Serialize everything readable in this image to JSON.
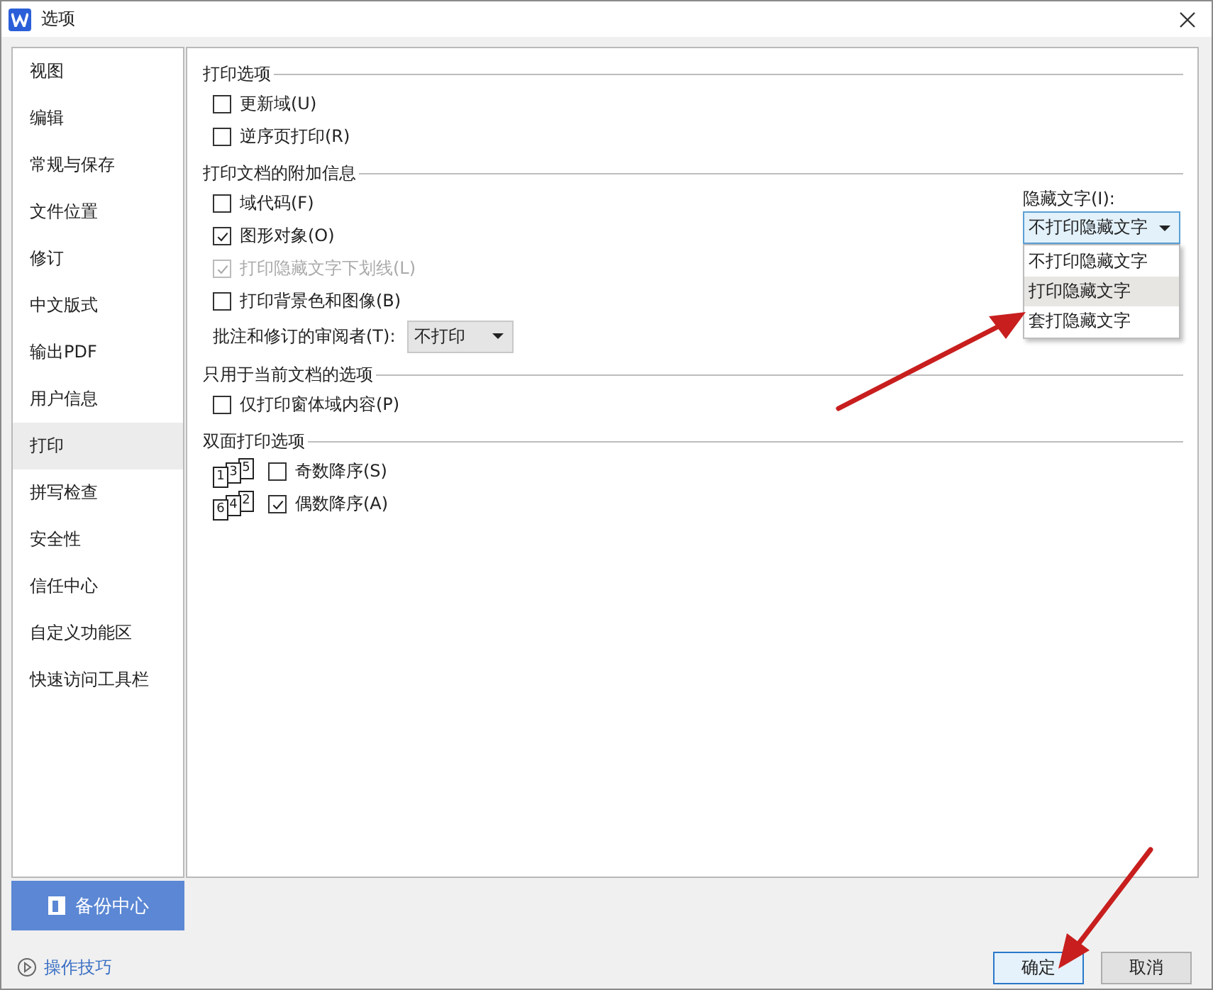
{
  "window": {
    "title": "选项"
  },
  "sidebar": {
    "items": [
      {
        "label": "视图",
        "selected": false
      },
      {
        "label": "编辑",
        "selected": false
      },
      {
        "label": "常规与保存",
        "selected": false
      },
      {
        "label": "文件位置",
        "selected": false
      },
      {
        "label": "修订",
        "selected": false
      },
      {
        "label": "中文版式",
        "selected": false
      },
      {
        "label": "输出PDF",
        "selected": false
      },
      {
        "label": "用户信息",
        "selected": false
      },
      {
        "label": "打印",
        "selected": true
      },
      {
        "label": "拼写检查",
        "selected": false
      },
      {
        "label": "安全性",
        "selected": false
      },
      {
        "label": "信任中心",
        "selected": false
      },
      {
        "label": "自定义功能区",
        "selected": false
      },
      {
        "label": "快速访问工具栏",
        "selected": false
      }
    ]
  },
  "backup_button": "备份中心",
  "tips_link": "操作技巧",
  "sections": [
    {
      "title": "打印选项",
      "items": [
        {
          "kind": "checkbox",
          "label": "更新域(U)",
          "checked": false,
          "disabled": false
        },
        {
          "kind": "checkbox",
          "label": "逆序页打印(R)",
          "checked": false,
          "disabled": false
        }
      ]
    },
    {
      "title": "打印文档的附加信息",
      "items": [
        {
          "kind": "checkbox",
          "label": "域代码(F)",
          "checked": false,
          "disabled": false
        },
        {
          "kind": "checkbox",
          "label": "图形对象(O)",
          "checked": true,
          "disabled": false
        },
        {
          "kind": "checkbox",
          "label": "打印隐藏文字下划线(L)",
          "checked": true,
          "disabled": true
        },
        {
          "kind": "checkbox",
          "label": "打印背景色和图像(B)",
          "checked": false,
          "disabled": false
        },
        {
          "kind": "select",
          "label": "批注和修订的审阅者(T):",
          "value": "不打印"
        }
      ],
      "hidden_text": {
        "label": "隐藏文字(I):",
        "value": "不打印隐藏文字",
        "expanded": true,
        "options": [
          {
            "label": "不打印隐藏文字",
            "highlighted": false
          },
          {
            "label": "打印隐藏文字",
            "highlighted": true
          },
          {
            "label": "套打隐藏文字",
            "highlighted": false
          }
        ]
      }
    },
    {
      "title": "只用于当前文档的选项",
      "items": [
        {
          "kind": "checkbox",
          "label": "仅打印窗体域内容(P)",
          "checked": false,
          "disabled": false
        }
      ]
    },
    {
      "title": "双面打印选项",
      "items": [
        {
          "kind": "duplex",
          "pages": [
            "1",
            "3",
            "5"
          ],
          "label": "奇数降序(S)",
          "checked": false,
          "disabled": false
        },
        {
          "kind": "duplex",
          "pages": [
            "6",
            "4",
            "2"
          ],
          "label": "偶数降序(A)",
          "checked": true,
          "disabled": false
        }
      ]
    }
  ],
  "buttons": [
    {
      "label": "确定",
      "default": true
    },
    {
      "label": "取消",
      "default": false
    }
  ]
}
